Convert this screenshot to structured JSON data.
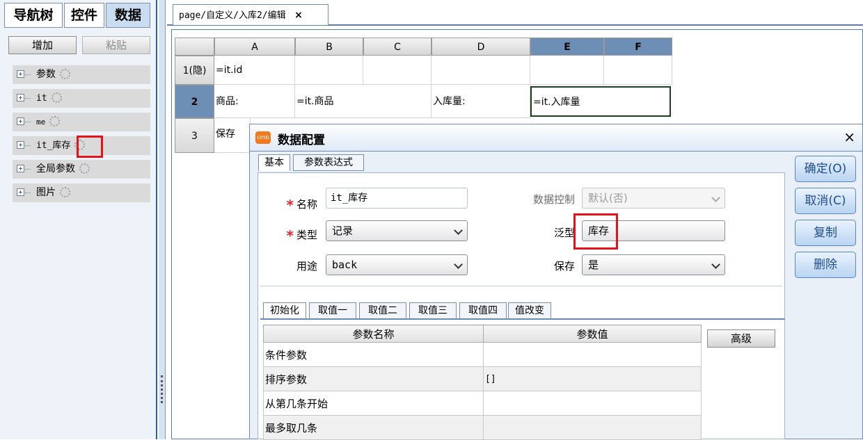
{
  "left_panel": {
    "tabs": [
      "导航树",
      "控件",
      "数据"
    ],
    "buttons": {
      "add": "增加",
      "paste": "粘贴"
    },
    "tree": [
      "参数",
      "it",
      "me",
      "it_库存",
      "全局参数",
      "图片"
    ]
  },
  "editor": {
    "tab_title": "page/自定义/入库2/编辑",
    "tab_close": "×",
    "columns": [
      "A",
      "B",
      "C",
      "D",
      "E",
      "F"
    ],
    "rows": [
      "1(隐)",
      "2",
      "3"
    ],
    "cells": {
      "A1": "=it.id",
      "A2": "商品:",
      "B2": "=it.商品",
      "D2": "入库量:",
      "E2": "=it.入库量",
      "A3": "保存"
    }
  },
  "dialog": {
    "title": "数据配置",
    "close": "×",
    "icon_text": "cmb",
    "tabs": [
      "基本",
      "参数表达式"
    ],
    "form": {
      "name_label": "名称",
      "name_value": "it_库存",
      "type_label": "类型",
      "type_value": "记录",
      "usage_label": "用途",
      "usage_value": "back",
      "data_control_label": "数据控制",
      "data_control_value": "默认(否)",
      "generic_label": "泛型",
      "generic_value": "库存",
      "save_label": "保存",
      "save_value": "是"
    },
    "subtabs": [
      "初始化",
      "取值一",
      "取值二",
      "取值三",
      "取值四",
      "值改变"
    ],
    "table": {
      "headers": [
        "参数名称",
        "参数值"
      ],
      "rows": [
        {
          "name": "条件参数",
          "value": ""
        },
        {
          "name": "排序参数",
          "value": "[]"
        },
        {
          "name": "从第几条开始",
          "value": ""
        },
        {
          "name": "最多取几条",
          "value": ""
        }
      ]
    },
    "advanced_button": "高级",
    "side_buttons": [
      "确定(O)",
      "取消(C)",
      "复制",
      "删除"
    ]
  },
  "colors": {
    "accent": "#1e4d8f",
    "selected_header": "#6e8fb5",
    "highlight": "#e8101a"
  }
}
